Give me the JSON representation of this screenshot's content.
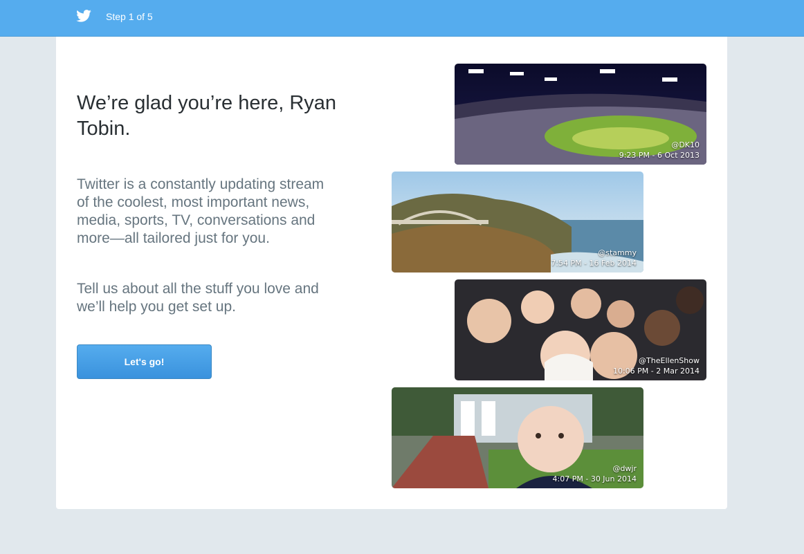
{
  "header": {
    "step_label": "Step 1 of 5",
    "icon": "twitter-bird-icon",
    "bg_color": "#55acee"
  },
  "welcome": {
    "headline": "We’re glad you’re here, Ryan Tobin.",
    "intro": "Twitter is a constantly updating stream of the coolest, most important news, media, sports, TV, conversations and more—all tailored just for you.",
    "prompt": "Tell us about all the stuff you love and we’ll help you get set up.",
    "cta_label": "Let's go!"
  },
  "photos": [
    {
      "handle": "@DK10",
      "timestamp": "9:23 PM - 6 Oct 2013"
    },
    {
      "handle": "@stammy",
      "timestamp": "7:54 PM - 16 Feb 2014"
    },
    {
      "handle": "@TheEllenShow",
      "timestamp": "10:06 PM - 2 Mar 2014"
    },
    {
      "handle": "@dwjr",
      "timestamp": "4:07 PM - 30 Jun 2014"
    }
  ]
}
